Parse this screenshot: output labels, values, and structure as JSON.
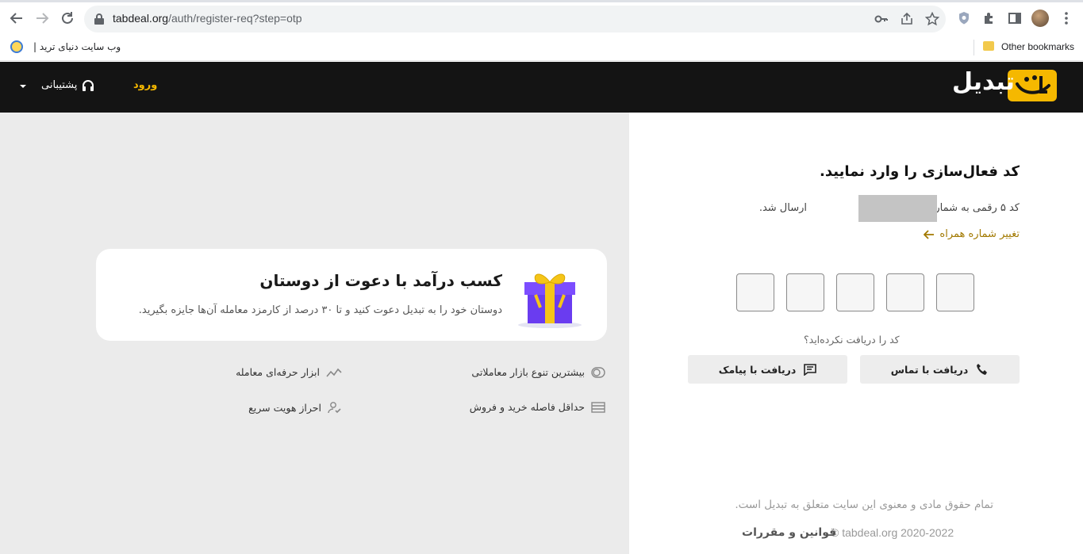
{
  "browser": {
    "url_host": "tabdeal.org",
    "url_path": "/auth/register-req?step=otp",
    "bookmark_label": "وب سایت دنیای ترید |",
    "other_bookmarks": "Other bookmarks"
  },
  "header": {
    "logo_text": "تبدیل",
    "login_label": "ورود",
    "support_label": "پشتیبانی",
    "brand_color": "#f5b800"
  },
  "promo": {
    "title": "کسب درآمد با دعوت از دوستان",
    "description": "دوستان خود را به تبدیل دعوت کنید و تا ۳۰ درصد از کارمزد معامله آن‌ها جایزه بگیرید.",
    "features": [
      {
        "label": "بیشترین تنوع بازار معاملاتی",
        "icon": "toggle-icon"
      },
      {
        "label": "ابزار حرفه‌ای معامله",
        "icon": "chart-trend-icon"
      },
      {
        "label": "حداقل فاصله خرید و فروش",
        "icon": "list-lines-icon"
      },
      {
        "label": "احراز هویت سریع",
        "icon": "user-check-icon"
      }
    ]
  },
  "auth": {
    "title": "کد فعال‌سازی را وارد نمایید.",
    "sent_prefix": "کد ۵ رقمی به شماره",
    "sent_suffix": "ارسال شد.",
    "change_number": "تغییر شماره همراه",
    "otp_count": 5,
    "not_received": "کد را دریافت نکرده‌اید؟",
    "call_label": "دریافت با تماس",
    "sms_label": "دریافت با پیامک",
    "copyright": "تمام حقوق مادی و معنوی این سایت متعلق به تبدیل است.",
    "copyright_year": "© tabdeal.org 2020-2022",
    "terms": "قوانین و مقررات"
  }
}
